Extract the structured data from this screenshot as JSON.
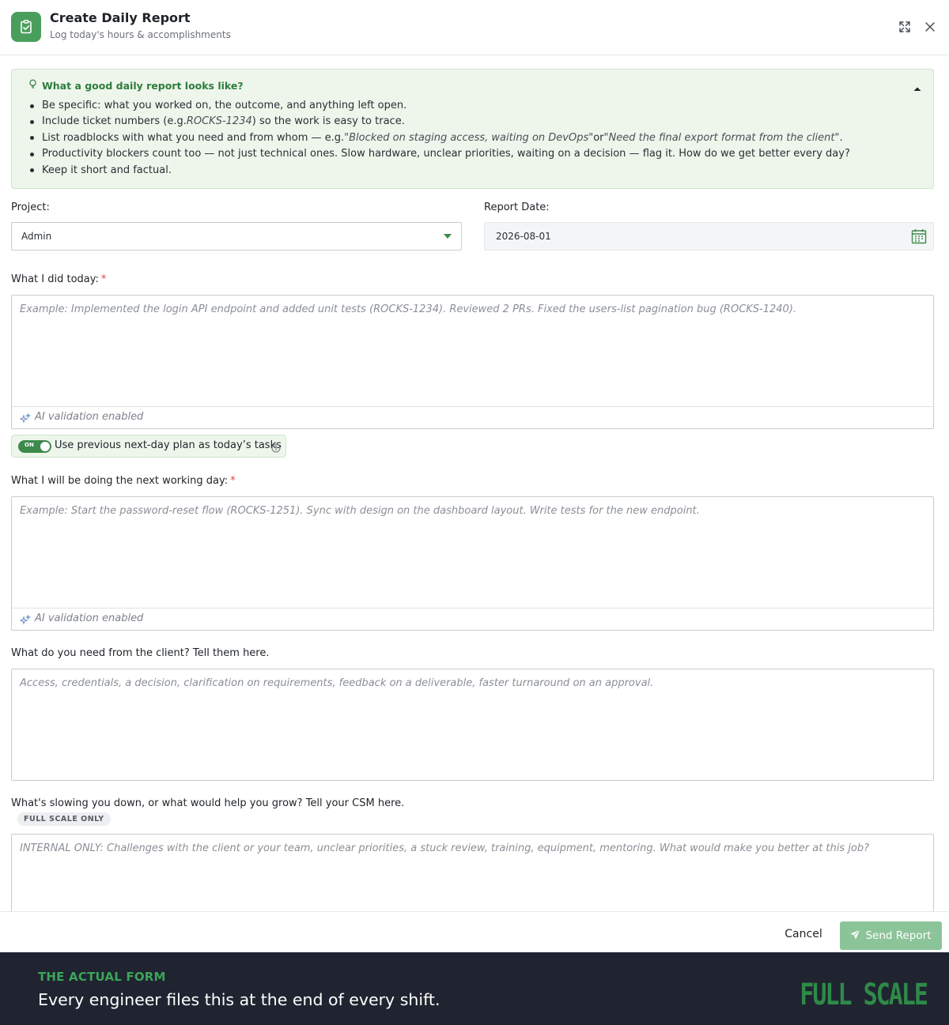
{
  "header": {
    "title": "Create Daily Report",
    "subtitle": "Log today's hours & accomplishments",
    "icon": "clipboard-check-icon"
  },
  "tips": {
    "title": "What a good daily report looks like?",
    "items": {
      "i0": "Be specific: what you worked on, the outcome, and anything left open.",
      "i1a": "Include ticket numbers (e.g. ",
      "i1b": "ROCKS-1234",
      "i1c": ") so the work is easy to trace.",
      "i2a": "List roadblocks with what you need and from whom — e.g. ",
      "i2b": "\"Blocked on staging access, waiting on DevOps\"",
      "i2c": " or ",
      "i2d": "\"Need the final export format from the client\"",
      "i2e": ".",
      "i3": "Productivity blockers count too — not just technical ones. Slow hardware, unclear priorities, waiting on a decision — flag it. How do we get better every day?",
      "i4": "Keep it short and factual."
    }
  },
  "form": {
    "project_label": "Project:",
    "project_value": "Admin",
    "date_label": "Report Date:",
    "date_value": "2026-08-01",
    "today_label": "What I did today:",
    "required_mark": "*",
    "today_placeholder": "Example: Implemented the login API endpoint and added unit tests (ROCKS-1234). Reviewed 2 PRs. Fixed the users-list pagination bug (ROCKS-1240).",
    "ai_validation": "AI validation enabled",
    "toggle_state": "ON",
    "toggle_label": "Use previous next-day plan as today’s tasks",
    "next_label": "What I will be doing the next working day:",
    "next_placeholder": "Example: Start the password-reset flow (ROCKS-1251). Sync with design on the dashboard layout. Write tests for the new endpoint.",
    "client_label": "What do you need from the client? Tell them here.",
    "client_placeholder": "Access, credentials, a decision, clarification on requirements, feedback on a deliverable, faster turnaround on an approval.",
    "csm_label": "What's slowing you down, or what would help you grow? Tell your CSM here.",
    "csm_badge": "FULL SCALE ONLY",
    "csm_placeholder": "INTERNAL ONLY: Challenges with the client or your team, unclear priorities, a stuck review, training, equipment, mentoring. What would make you better at this job?"
  },
  "footer": {
    "cancel": "Cancel",
    "send": "Send Report"
  },
  "banner": {
    "kicker": "THE ACTUAL FORM",
    "headline": "Every engineer files this at the end of every shift.",
    "brand": "FULL SCALE"
  },
  "colors": {
    "accent": "#4a9e5c",
    "tips_bg": "#eef6ec",
    "send_button": "#8cc49a",
    "banner_bg": "#1f2430",
    "brand_green": "#2f8a48"
  }
}
